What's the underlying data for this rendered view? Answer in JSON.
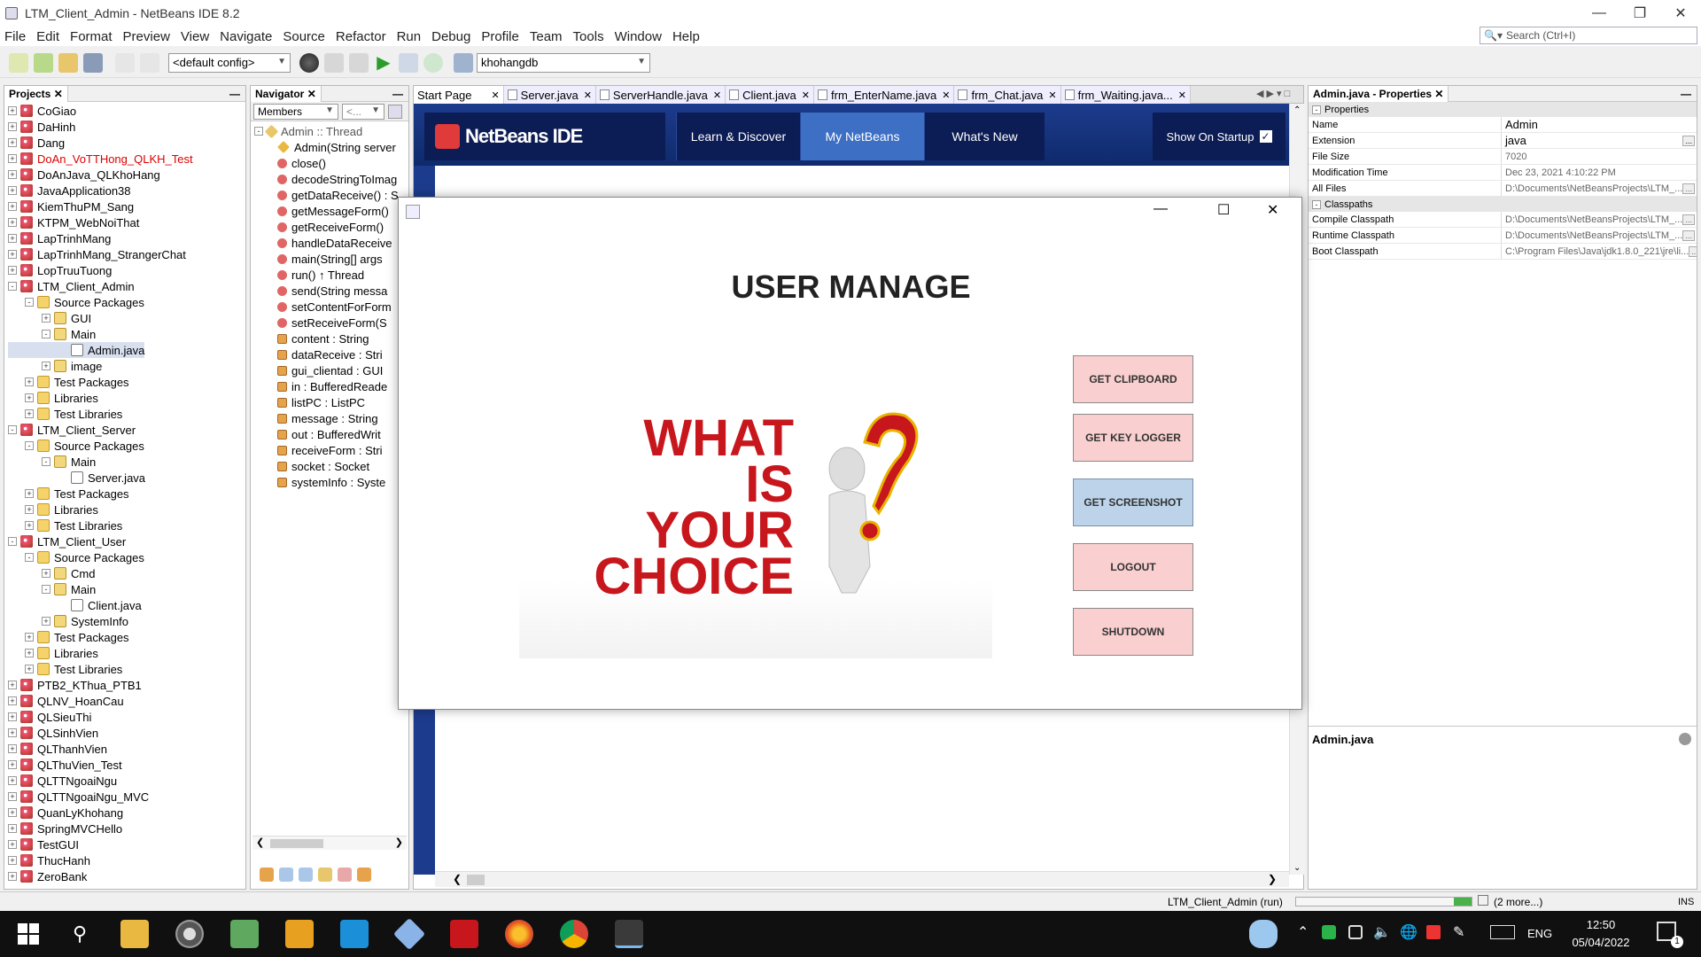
{
  "window": {
    "title": "LTM_Client_Admin - NetBeans IDE 8.2"
  },
  "menu": [
    "File",
    "Edit",
    "Format",
    "Preview",
    "View",
    "Navigate",
    "Source",
    "Refactor",
    "Run",
    "Debug",
    "Profile",
    "Team",
    "Tools",
    "Window",
    "Help"
  ],
  "search": {
    "placeholder": "Search (Ctrl+I)"
  },
  "toolbar": {
    "config": "<default config>",
    "db": "khohangdb"
  },
  "projects": {
    "title": "Projects",
    "rows": [
      {
        "label": "CoGiao",
        "level": 0,
        "type": "proj",
        "tog": "+"
      },
      {
        "label": "DaHinh",
        "level": 0,
        "type": "proj",
        "tog": "+"
      },
      {
        "label": "Dang",
        "level": 0,
        "type": "proj",
        "tog": "+"
      },
      {
        "label": "DoAn_VoTTHong_QLKH_Test",
        "level": 0,
        "type": "proj",
        "tog": "+",
        "red": true
      },
      {
        "label": "DoAnJava_QLKhoHang",
        "level": 0,
        "type": "proj",
        "tog": "+"
      },
      {
        "label": "JavaApplication38",
        "level": 0,
        "type": "proj",
        "tog": "+"
      },
      {
        "label": "KiemThuPM_Sang",
        "level": 0,
        "type": "proj",
        "tog": "+"
      },
      {
        "label": "KTPM_WebNoiThat",
        "level": 0,
        "type": "proj",
        "tog": "+"
      },
      {
        "label": "LapTrinhMang",
        "level": 0,
        "type": "proj",
        "tog": "+"
      },
      {
        "label": "LapTrinhMang_StrangerChat",
        "level": 0,
        "type": "proj",
        "tog": "+"
      },
      {
        "label": "LopTruuTuong",
        "level": 0,
        "type": "proj",
        "tog": "+"
      },
      {
        "label": "LTM_Client_Admin",
        "level": 0,
        "type": "proj",
        "tog": "-"
      },
      {
        "label": "Source Packages",
        "level": 1,
        "type": "fold",
        "tog": "-"
      },
      {
        "label": "GUI",
        "level": 2,
        "type": "pkg",
        "tog": "+"
      },
      {
        "label": "Main",
        "level": 2,
        "type": "pkg",
        "tog": "-"
      },
      {
        "label": "Admin.java",
        "level": 3,
        "type": "jfile",
        "tog": "",
        "sel": true
      },
      {
        "label": "image",
        "level": 2,
        "type": "pkg",
        "tog": "+"
      },
      {
        "label": "Test Packages",
        "level": 1,
        "type": "fold",
        "tog": "+"
      },
      {
        "label": "Libraries",
        "level": 1,
        "type": "fold",
        "tog": "+"
      },
      {
        "label": "Test Libraries",
        "level": 1,
        "type": "fold",
        "tog": "+"
      },
      {
        "label": "LTM_Client_Server",
        "level": 0,
        "type": "proj",
        "tog": "-"
      },
      {
        "label": "Source Packages",
        "level": 1,
        "type": "fold",
        "tog": "-"
      },
      {
        "label": "Main",
        "level": 2,
        "type": "pkg",
        "tog": "-"
      },
      {
        "label": "Server.java",
        "level": 3,
        "type": "jfile",
        "tog": ""
      },
      {
        "label": "Test Packages",
        "level": 1,
        "type": "fold",
        "tog": "+"
      },
      {
        "label": "Libraries",
        "level": 1,
        "type": "fold",
        "tog": "+"
      },
      {
        "label": "Test Libraries",
        "level": 1,
        "type": "fold",
        "tog": "+"
      },
      {
        "label": "LTM_Client_User",
        "level": 0,
        "type": "proj",
        "tog": "-"
      },
      {
        "label": "Source Packages",
        "level": 1,
        "type": "fold",
        "tog": "-"
      },
      {
        "label": "Cmd",
        "level": 2,
        "type": "pkg",
        "tog": "+"
      },
      {
        "label": "Main",
        "level": 2,
        "type": "pkg",
        "tog": "-"
      },
      {
        "label": "Client.java",
        "level": 3,
        "type": "jfile",
        "tog": ""
      },
      {
        "label": "SystemInfo",
        "level": 2,
        "type": "pkg",
        "tog": "+"
      },
      {
        "label": "Test Packages",
        "level": 1,
        "type": "fold",
        "tog": "+"
      },
      {
        "label": "Libraries",
        "level": 1,
        "type": "fold",
        "tog": "+"
      },
      {
        "label": "Test Libraries",
        "level": 1,
        "type": "fold",
        "tog": "+"
      },
      {
        "label": "PTB2_KThua_PTB1",
        "level": 0,
        "type": "proj",
        "tog": "+"
      },
      {
        "label": "QLNV_HoanCau",
        "level": 0,
        "type": "proj",
        "tog": "+"
      },
      {
        "label": "QLSieuThi",
        "level": 0,
        "type": "proj",
        "tog": "+"
      },
      {
        "label": "QLSinhVien",
        "level": 0,
        "type": "proj",
        "tog": "+"
      },
      {
        "label": "QLThanhVien",
        "level": 0,
        "type": "proj",
        "tog": "+"
      },
      {
        "label": "QLThuVien_Test",
        "level": 0,
        "type": "proj",
        "tog": "+"
      },
      {
        "label": "QLTTNgoaiNgu",
        "level": 0,
        "type": "proj",
        "tog": "+"
      },
      {
        "label": "QLTTNgoaiNgu_MVC",
        "level": 0,
        "type": "proj",
        "tog": "+"
      },
      {
        "label": "QuanLyKhohang",
        "level": 0,
        "type": "proj",
        "tog": "+"
      },
      {
        "label": "SpringMVCHello",
        "level": 0,
        "type": "proj",
        "tog": "+"
      },
      {
        "label": "TestGUI",
        "level": 0,
        "type": "proj",
        "tog": "+"
      },
      {
        "label": "ThucHanh",
        "level": 0,
        "type": "proj",
        "tog": "+"
      },
      {
        "label": "ZeroBank",
        "level": 0,
        "type": "proj",
        "tog": "+"
      }
    ]
  },
  "navigator": {
    "title": "Navigator",
    "filter": "Members",
    "filter2": "<...",
    "root": "Admin :: Thread",
    "rows": [
      {
        "name": "Admin(String server",
        "kind": "ctor"
      },
      {
        "name": "close()",
        "kind": "meth"
      },
      {
        "name": "decodeStringToImag",
        "kind": "meth"
      },
      {
        "name": "getDataReceive() : S",
        "kind": "meth"
      },
      {
        "name": "getMessageForm()",
        "kind": "meth"
      },
      {
        "name": "getReceiveForm()",
        "kind": "meth"
      },
      {
        "name": "handleDataReceive",
        "kind": "meth"
      },
      {
        "name": "main(String[] args",
        "kind": "meth"
      },
      {
        "name": "run() ↑ Thread",
        "kind": "meth"
      },
      {
        "name": "send(String messa",
        "kind": "meth"
      },
      {
        "name": "setContentForForm",
        "kind": "meth"
      },
      {
        "name": "setReceiveForm(S",
        "kind": "meth"
      },
      {
        "name": "content : String",
        "kind": "fld"
      },
      {
        "name": "dataReceive : Stri",
        "kind": "fld"
      },
      {
        "name": "gui_clientad : GUI",
        "kind": "fld"
      },
      {
        "name": "in : BufferedReade",
        "kind": "fld"
      },
      {
        "name": "listPC : ListPC",
        "kind": "fld"
      },
      {
        "name": "message : String",
        "kind": "fld"
      },
      {
        "name": "out : BufferedWrit",
        "kind": "fld"
      },
      {
        "name": "receiveForm : Stri",
        "kind": "fld"
      },
      {
        "name": "socket : Socket",
        "kind": "fld"
      },
      {
        "name": "systemInfo : Syste",
        "kind": "fld"
      }
    ]
  },
  "editor": {
    "tabs": [
      "Start Page",
      "Server.java",
      "ServerHandle.java",
      "Client.java",
      "frm_EnterName.java",
      "frm_Chat.java",
      "frm_Waiting.java..."
    ],
    "startpage": {
      "logo": "NetBeans IDE",
      "nav": [
        "Learn & Discover",
        "My NetBeans",
        "What's New"
      ],
      "show_on_startup": "Show On Startup"
    }
  },
  "dialog": {
    "heading": "USER MANAGE",
    "image_text": [
      "WHAT",
      "IS",
      "YOUR",
      "CHOICE"
    ],
    "buttons": [
      {
        "label": "GET CLIPBOARD",
        "state": "normal"
      },
      {
        "label": "GET KEY LOGGER",
        "state": "normal"
      },
      {
        "label": "GET SCREENSHOT",
        "state": "focused"
      },
      {
        "label": "LOGOUT",
        "state": "normal"
      },
      {
        "label": "SHUTDOWN",
        "state": "normal"
      }
    ]
  },
  "properties": {
    "title": "Admin.java - Properties",
    "sections": [
      {
        "name": "Properties",
        "rows": [
          {
            "k": "Name",
            "v": "Admin",
            "dark": true
          },
          {
            "k": "Extension",
            "v": "java",
            "dark": true,
            "btn": true
          },
          {
            "k": "File Size",
            "v": "7020"
          },
          {
            "k": "Modification Time",
            "v": "Dec 23, 2021 4:10:22 PM"
          },
          {
            "k": "All Files",
            "v": "D:\\Documents\\NetBeansProjects\\LTM_...",
            "btn": true
          }
        ]
      },
      {
        "name": "Classpaths",
        "rows": [
          {
            "k": "Compile Classpath",
            "v": "D:\\Documents\\NetBeansProjects\\LTM_...",
            "btn": true
          },
          {
            "k": "Runtime Classpath",
            "v": "D:\\Documents\\NetBeansProjects\\LTM_...",
            "btn": true
          },
          {
            "k": "Boot Classpath",
            "v": "C:\\Program Files\\Java\\jdk1.8.0_221\\jre\\li...",
            "btn": true
          }
        ]
      }
    ],
    "footer": "Admin.java"
  },
  "status": {
    "run": "LTM_Client_Admin (run)",
    "more": "(2 more...)",
    "mode": "INS"
  },
  "taskbar": {
    "lang": "ENG",
    "time": "12:50",
    "date": "05/04/2022",
    "notif": "1"
  }
}
